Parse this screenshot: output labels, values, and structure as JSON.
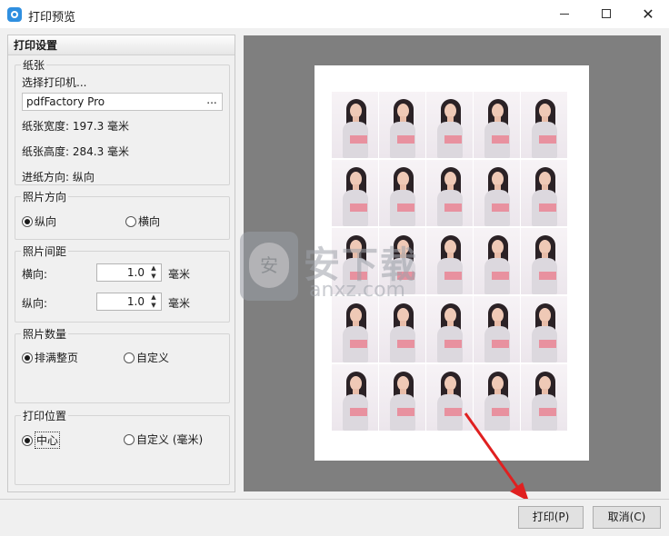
{
  "window": {
    "title": "打印预览",
    "controls": {
      "minimize": "—",
      "maximize": "☐",
      "close": "✕"
    }
  },
  "settings": {
    "header": "打印设置",
    "paper": {
      "group_title": "纸张",
      "select_printer_label": "选择打印机...",
      "printer_name": "pdfFactory Pro",
      "browse_label": "...",
      "width_text": "纸张宽度: 197.3 毫米",
      "height_text": "纸张高度: 284.3 毫米",
      "feed_direction_text": "进纸方向: 纵向"
    },
    "photo_orientation": {
      "group_title": "照片方向",
      "options": [
        {
          "label": "纵向",
          "selected": true
        },
        {
          "label": "横向",
          "selected": false
        }
      ]
    },
    "photo_spacing": {
      "group_title": "照片间距",
      "horizontal_label": "横向:",
      "horizontal_value": "1.0",
      "vertical_label": "纵向:",
      "vertical_value": "1.0",
      "unit": "毫米"
    },
    "photo_count": {
      "group_title": "照片数量",
      "options": [
        {
          "label": "排满整页",
          "selected": true
        },
        {
          "label": "自定义",
          "selected": false
        }
      ]
    },
    "print_position": {
      "group_title": "打印位置",
      "options": [
        {
          "label": "中心",
          "selected": true
        },
        {
          "label": "自定义 (毫米)",
          "selected": false
        }
      ]
    }
  },
  "preview": {
    "grid_rows": 5,
    "grid_columns": 5
  },
  "watermark": {
    "mark": "安",
    "text": "安下载",
    "sub": "anxz.com"
  },
  "footer": {
    "print_button": "打印(P)",
    "cancel_button": "取消(C)"
  },
  "colors": {
    "dialog_bg": "#f0f0f0",
    "preview_bg": "#7f7f7f",
    "arrow": "#e02020"
  }
}
